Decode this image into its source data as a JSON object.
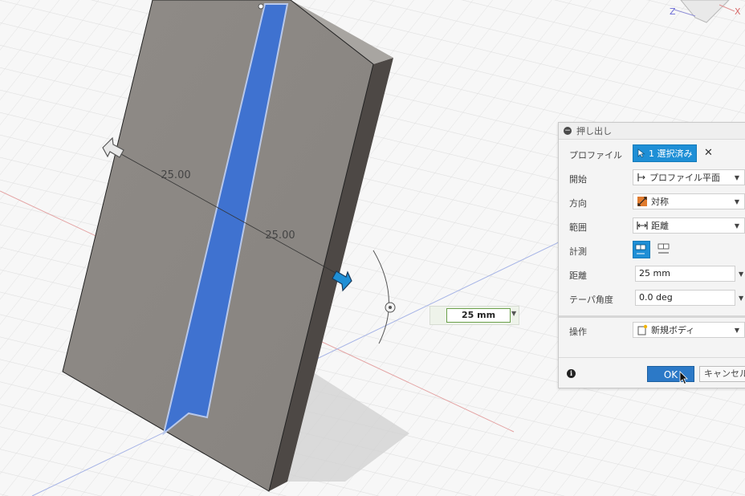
{
  "viewcube": {
    "z_label": "Z",
    "x_label": "X"
  },
  "canvas": {
    "dimension_left": "25.00",
    "dimension_right": "25.00",
    "distance_input_value": "25 mm"
  },
  "dialog": {
    "title": "押し出し",
    "rows": {
      "profile": {
        "label": "プロファイル",
        "value": "1 選択済み"
      },
      "start": {
        "label": "開始",
        "value": "プロファイル平面"
      },
      "direction": {
        "label": "方向",
        "value": "対称"
      },
      "extent": {
        "label": "範囲",
        "value": "距離"
      },
      "measure": {
        "label": "計測"
      },
      "distance": {
        "label": "距離",
        "value": "25 mm"
      },
      "taper": {
        "label": "テーパ角度",
        "value": "0.0 deg"
      },
      "operation": {
        "label": "操作",
        "value": "新規ボディ"
      }
    },
    "ok_label": "OK",
    "cancel_label": "キャンセル"
  },
  "colors": {
    "selection_blue": "#3f72d0",
    "button_blue": "#1e8fd6",
    "body_gray": "#8c8985",
    "side_dark": "#4a4542"
  }
}
